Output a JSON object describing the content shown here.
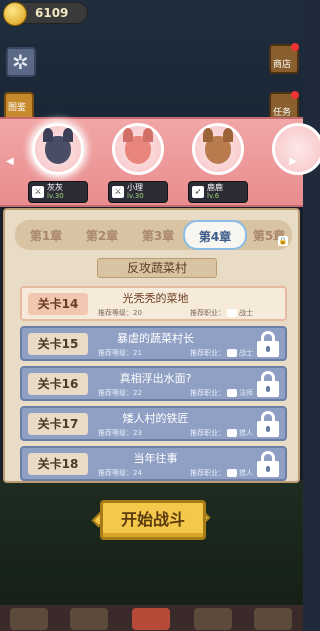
{
  "currency": {
    "coins": "6109"
  },
  "side_buttons": {
    "left2_label": "图鉴",
    "right1_label": "商店",
    "right2_label": "任务"
  },
  "heroes": [
    {
      "name": "灰灰",
      "level": "lv.30",
      "selected": true,
      "fur": "#4a4d66",
      "ear": "#3c3f56"
    },
    {
      "name": "小理",
      "level": "lv.30",
      "selected": false,
      "fur": "#e8857d",
      "ear": "#d26f69"
    },
    {
      "name": "鹿鹿",
      "level": "lv.6",
      "selected": false,
      "fur": "#b77b4e",
      "ear": "#9c6339"
    }
  ],
  "chapters": {
    "tabs": [
      "第1章",
      "第2章",
      "第3章",
      "第4章",
      "第5章"
    ],
    "active_index": 3
  },
  "region_title": "反攻蔬菜村",
  "levels": [
    {
      "badge": "关卡14",
      "name": "光秃秃的菜地",
      "rec_level_label": "推荐等级：",
      "rec_level": "20",
      "rec_class_label": "推荐职业：",
      "rec_class": "战士",
      "locked": false
    },
    {
      "badge": "关卡15",
      "name": "暴虐的蔬菜村长",
      "rec_level_label": "推荐等级：",
      "rec_level": "21",
      "rec_class_label": "推荐职业：",
      "rec_class": "战士",
      "locked": true
    },
    {
      "badge": "关卡16",
      "name": "真相浮出水面?",
      "rec_level_label": "推荐等级：",
      "rec_level": "22",
      "rec_class_label": "推荐职业：",
      "rec_class": "法师",
      "locked": true
    },
    {
      "badge": "关卡17",
      "name": "矮人村的铁匠",
      "rec_level_label": "推荐等级：",
      "rec_level": "23",
      "rec_class_label": "推荐职业：",
      "rec_class": "猎人",
      "locked": true
    },
    {
      "badge": "关卡18",
      "name": "当年往事",
      "rec_level_label": "推荐等级：",
      "rec_level": "24",
      "rec_class_label": "推荐职业：",
      "rec_class": "猎人",
      "locked": true
    }
  ],
  "start_button": "开始战斗"
}
